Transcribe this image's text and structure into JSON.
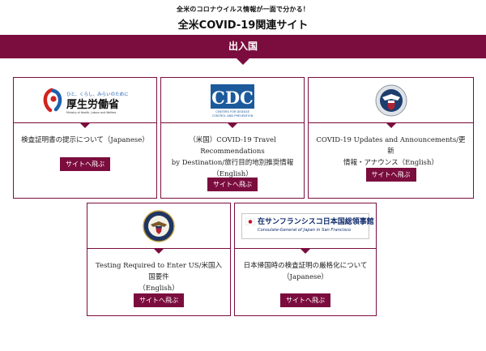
{
  "header": {
    "tagline": "全米のコロナウイルス情報が一面で分かる！",
    "title": "全米COVID-19関連サイト"
  },
  "section": {
    "title": "出入国"
  },
  "cards": [
    {
      "logo": "mhlw-logo",
      "logo_text": {
        "tagline": "ひと、くらし、みらいのために",
        "name": "厚生労働省",
        "sub": "Ministry of Health, Labour and Welfare"
      },
      "lines": [
        "検査証明書の提示について（Japanese）"
      ],
      "button": "サイトへ飛ぶ"
    },
    {
      "logo": "cdc-logo",
      "logo_text": {
        "name": "CDC",
        "sub1": "CENTERS FOR DISEASE",
        "sub2": "CONTROL AND PREVENTION"
      },
      "lines": [
        "（米国）COVID-19 Travel Recommendations",
        "by Destination/旅行目的地別推奨情報",
        "（English）"
      ],
      "button": "サイトへ飛ぶ"
    },
    {
      "logo": "dhs-seal",
      "lines": [
        "COVID-19 Updates and Announcements/更新",
        "情報・アナウンス（English）"
      ],
      "button": "サイトへ飛ぶ"
    },
    {
      "logo": "state-dept-seal",
      "lines": [
        "Testing Required to Enter US/米国入国要件",
        "（English）"
      ],
      "button": "サイトへ飛ぶ"
    },
    {
      "logo": "consulate-logo",
      "logo_text": {
        "name": "在サンフランシスコ日本国総領事館",
        "sub": "Consulate-General of Japan in San Francisco"
      },
      "lines": [
        "日本帰国時の検査証明の厳格化について",
        "（Japanese）"
      ],
      "button": "サイトへ飛ぶ"
    }
  ],
  "colors": {
    "accent": "#7b0d3e",
    "cdc_blue": "#1c5a9c",
    "mhlw_red": "#d2231f",
    "mhlw_blue": "#1f5fae"
  }
}
